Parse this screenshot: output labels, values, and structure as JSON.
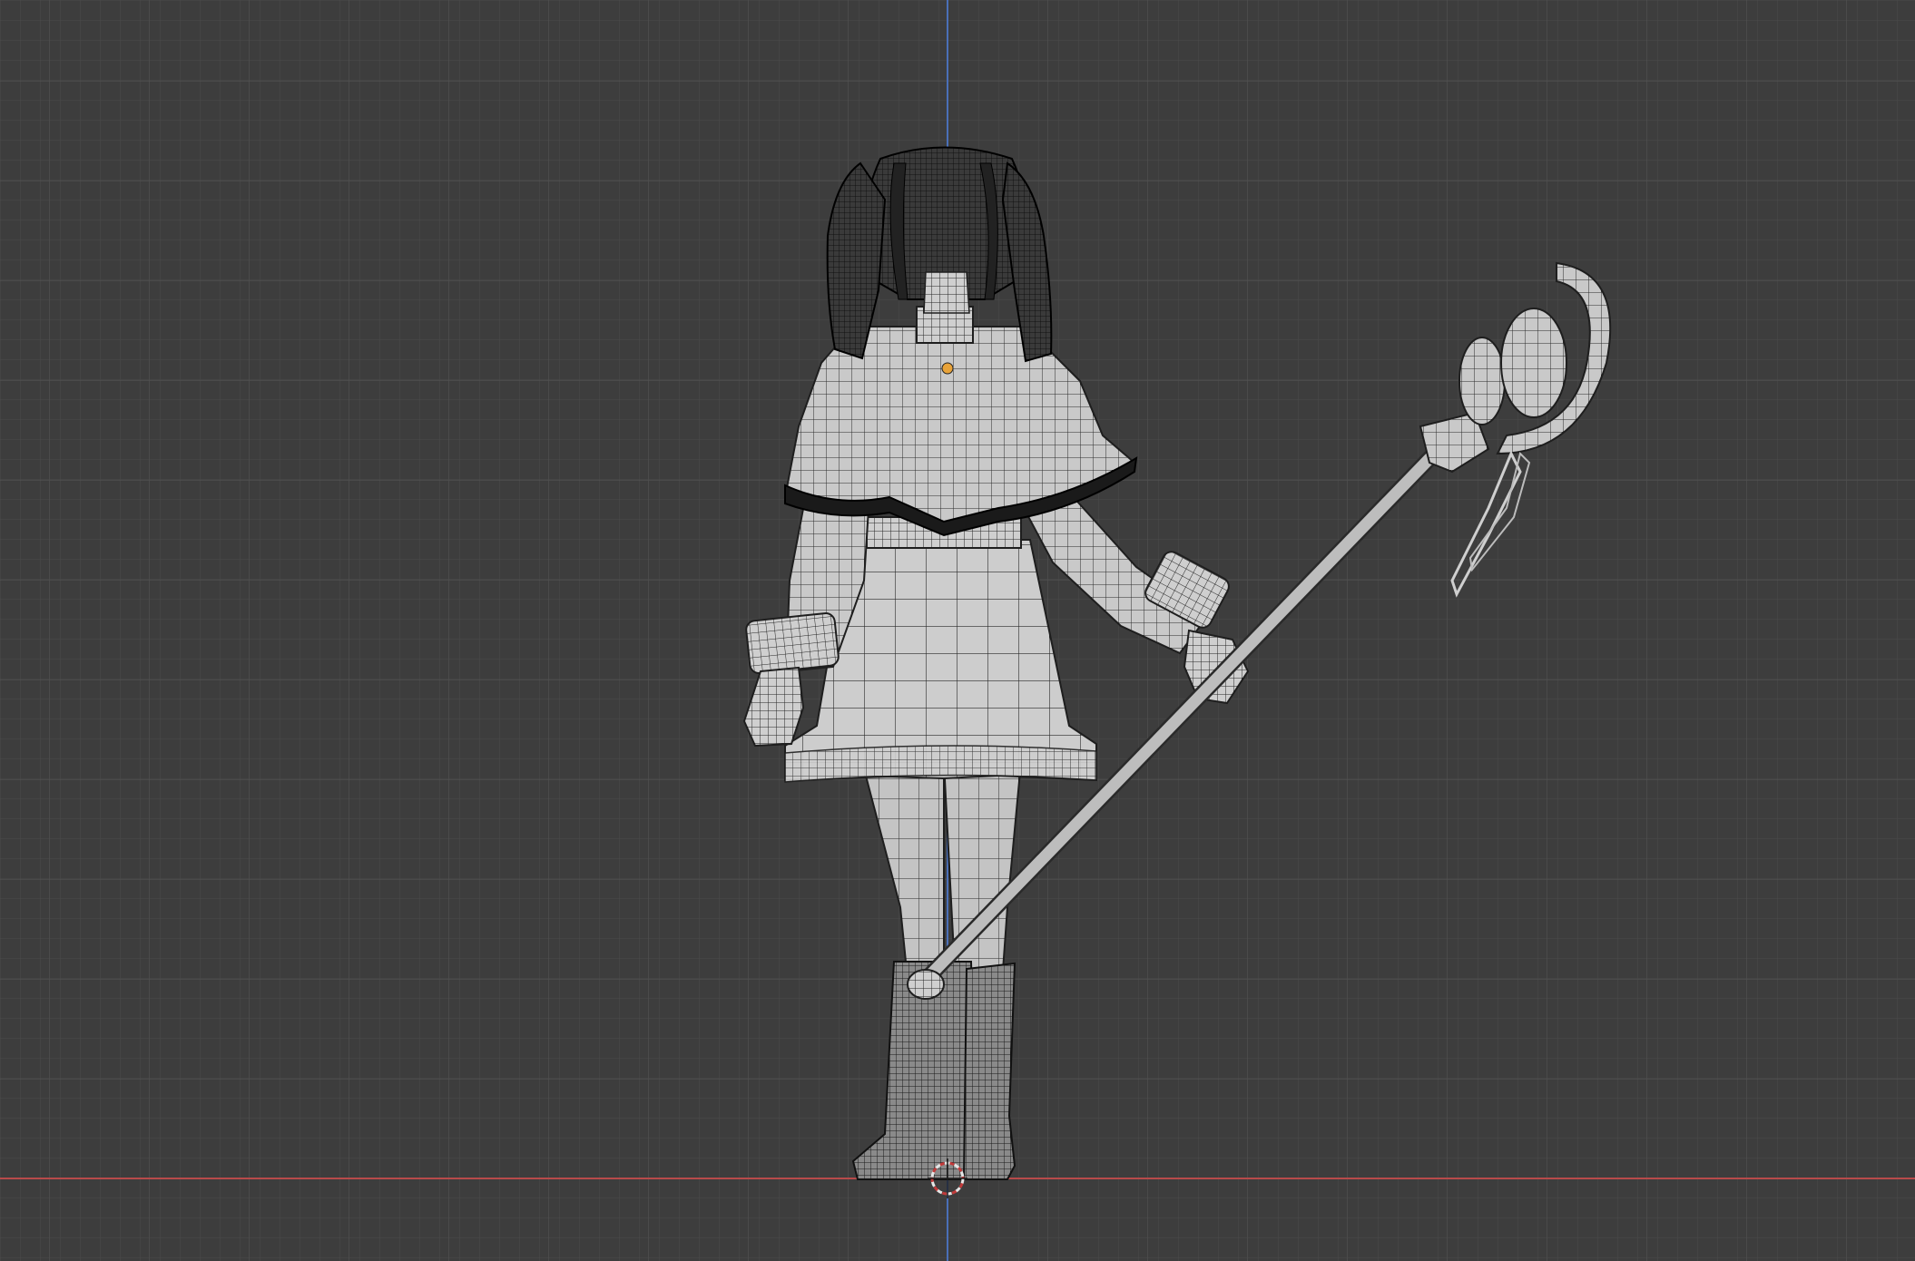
{
  "viewport": {
    "view": "back-orthographic",
    "shading": "solid-wireframe",
    "background_color": "#3d3d3d",
    "grid_color": "#4a4a4a",
    "grid_major_color": "#545454",
    "x_axis_color": "#b84a4a",
    "z_axis_color": "#4a6fb8"
  },
  "model": {
    "description_icon": "character-mesh",
    "origin_color": "#e8a33a",
    "cursor_icon": "3d-cursor"
  }
}
